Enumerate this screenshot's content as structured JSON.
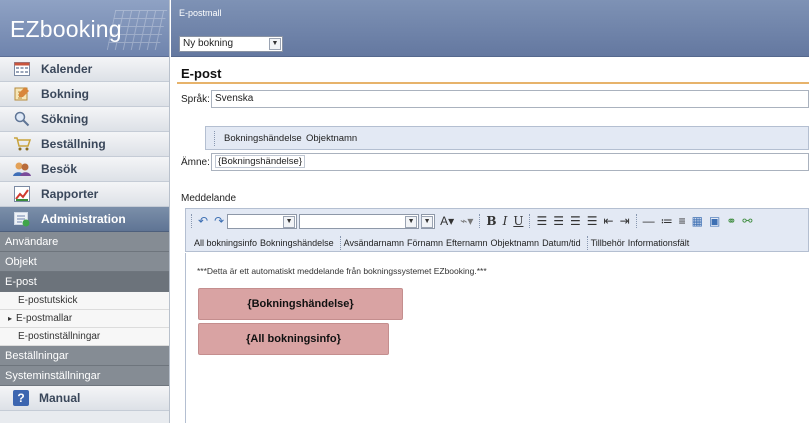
{
  "sidebar": {
    "logo": "EZbooking",
    "nav": [
      {
        "label": "Kalender",
        "icon": "calendar-icon"
      },
      {
        "label": "Bokning",
        "icon": "booking-icon"
      },
      {
        "label": "Sökning",
        "icon": "search-icon"
      },
      {
        "label": "Beställning",
        "icon": "cart-icon"
      },
      {
        "label": "Besök",
        "icon": "visitors-icon"
      },
      {
        "label": "Rapporter",
        "icon": "report-icon"
      },
      {
        "label": "Administration",
        "icon": "admin-icon"
      }
    ],
    "sub": [
      "Användare",
      "Objekt",
      "E-post"
    ],
    "epost_children": [
      "E-postutskick",
      "E-postmallar",
      "E-postinställningar"
    ],
    "sub_after": [
      "Beställningar",
      "Systeminställningar"
    ],
    "manual": "Manual",
    "manual_icon": "?"
  },
  "header": {
    "breadcrumb": "E-postmall",
    "template_select": "Ny bokning"
  },
  "main": {
    "title": "E-post",
    "language_label": "Språk:",
    "language_value": "Svenska",
    "placeholders": [
      "Bokningshändelse",
      "Objektnamn"
    ],
    "subject_label": "Ämne:",
    "subject_value": "{Bokningshändelse}",
    "message_label": "Meddelande"
  },
  "editor": {
    "insert_buttons": [
      "All bokningsinfo",
      "Bokningshändelse",
      "Avsändarnamn",
      "Förnamn",
      "Efternamn",
      "Objektnamn",
      "Datum/tid",
      "Tillbehör",
      "Informationsfält"
    ],
    "notice": "***Detta är ett automatiskt meddelande från bokningssystemet EZbooking.***",
    "blocks": [
      "{Bokningshändelse}",
      "{All bokningsinfo}"
    ]
  },
  "colors": {
    "accent_line": "#e7b36b",
    "block_fill": "#d9a3a3",
    "header_blue": "#6f84ad"
  }
}
